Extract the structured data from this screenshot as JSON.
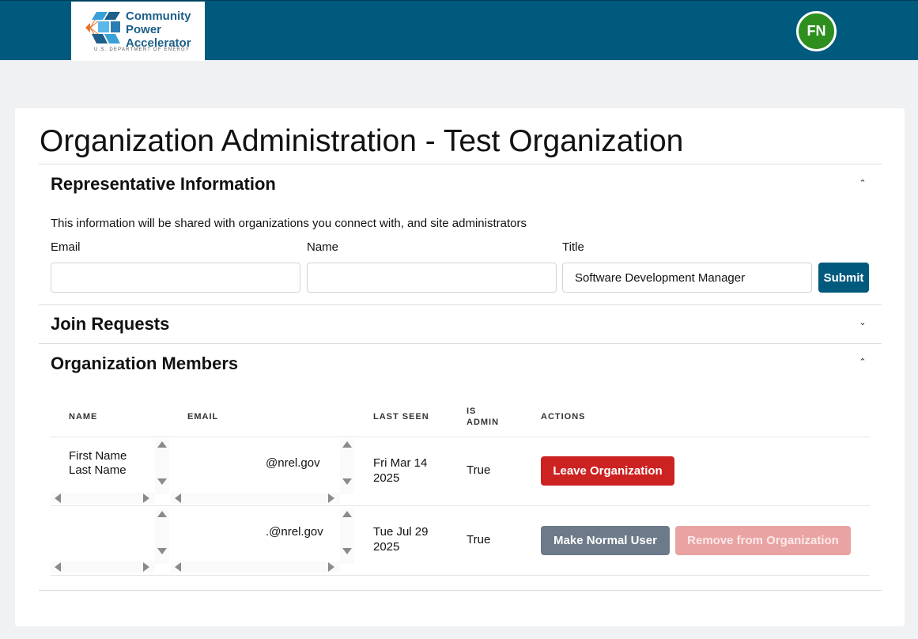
{
  "header": {
    "logo": {
      "line1": "Community",
      "line2": "Power",
      "line3": "Accelerator",
      "sub": "U.S. DEPARTMENT OF ENERGY"
    },
    "avatar_initials": "FN",
    "colors": {
      "bar": "#005a7d",
      "avatar": "#2e8f1e"
    }
  },
  "page": {
    "title": "Organization Administration - Test Organization"
  },
  "representative": {
    "title": "Representative Information",
    "description": "This information will be shared with organizations you connect with, and site administrators",
    "email_label": "Email",
    "email_value": "",
    "name_label": "Name",
    "name_value": "",
    "title_label": "Title",
    "title_value": "Software Development Manager",
    "submit_label": "Submit",
    "chevron": "chevron-up-icon"
  },
  "join_requests": {
    "title": "Join Requests",
    "chevron": "chevron-down-icon"
  },
  "members": {
    "title": "Organization Members",
    "chevron": "chevron-up-icon",
    "columns": {
      "name": "NAME",
      "email": "EMAIL",
      "last_seen": "LAST SEEN",
      "is_admin_1": "IS",
      "is_admin_2": "ADMIN",
      "actions": "ACTIONS"
    },
    "rows": [
      {
        "first_name": "First Name",
        "last_name": "Last Name",
        "email": "@nrel.gov",
        "last_seen_1": "Fri Mar 14",
        "last_seen_2": "2025",
        "is_admin": "True",
        "action_primary": "Leave Organization"
      },
      {
        "first_name": "",
        "last_name": "",
        "email": ".@nrel.gov",
        "last_seen_1": "Tue Jul 29",
        "last_seen_2": "2025",
        "is_admin": "True",
        "action_primary": "Make Normal User",
        "action_secondary": "Remove from Organization"
      }
    ]
  }
}
